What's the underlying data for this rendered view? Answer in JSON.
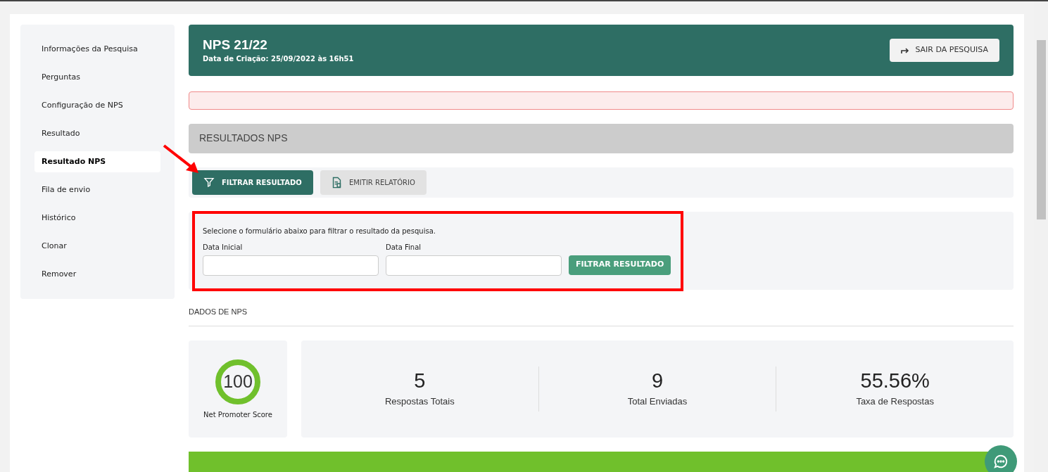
{
  "sidebar": {
    "items": [
      {
        "label": "Informações da Pesquisa",
        "selected": false
      },
      {
        "label": "Perguntas",
        "selected": false
      },
      {
        "label": "Configuração de NPS",
        "selected": false
      },
      {
        "label": "Resultado",
        "selected": false
      },
      {
        "label": "Resultado NPS",
        "selected": true
      },
      {
        "label": "Fila de envio",
        "selected": false
      },
      {
        "label": "Histórico",
        "selected": false
      },
      {
        "label": "Clonar",
        "selected": false
      },
      {
        "label": "Remover",
        "selected": false
      }
    ]
  },
  "header": {
    "title": "NPS 21/22",
    "subtitle": "Data de Criação: 25/09/2022 às 16h51",
    "exit_button": "SAIR DA PESQUISA"
  },
  "section_title": "RESULTADOS NPS",
  "toolbar": [
    {
      "label": "FILTRAR RESULTADO",
      "kind": "filter",
      "selected": true
    },
    {
      "label": "EMITIR RELATÓRIO",
      "kind": "report",
      "selected": false
    }
  ],
  "filter_form": {
    "hint": "Selecione o formulário abaixo para filtrar o resultado da pesquisa.",
    "fields": [
      {
        "label": "Data Inicial"
      },
      {
        "label": "Data Final"
      }
    ],
    "submit": "FILTRAR RESULTADO"
  },
  "data_title": "DADOS DE NPS",
  "nps": {
    "score": "100",
    "label": "Net Promoter Score"
  },
  "stats": [
    {
      "value": "5",
      "label": "Respostas Totais"
    },
    {
      "value": "9",
      "label": "Total Enviadas"
    },
    {
      "value": "55.56%",
      "label": "Taxa de Respostas"
    }
  ]
}
